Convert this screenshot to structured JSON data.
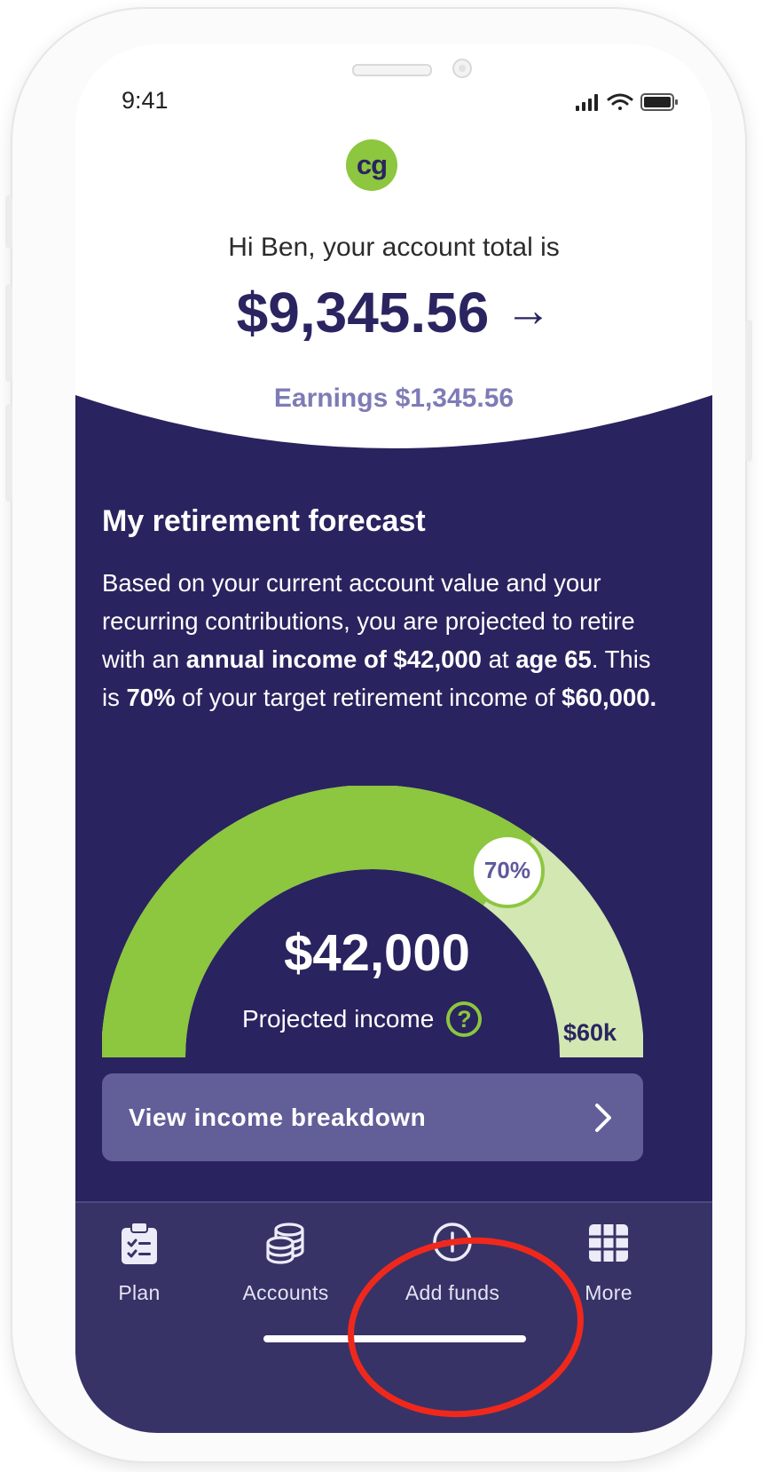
{
  "status_bar": {
    "time": "9:41"
  },
  "brand": {
    "logo_text": "cg",
    "color_green": "#8dc63f",
    "color_navy": "#2a2560"
  },
  "account": {
    "greeting": "Hi Ben, your account total is",
    "total": "$9,345.56",
    "arrow": "→",
    "earnings": "Earnings $1,345.56"
  },
  "forecast": {
    "title": "My retirement forecast",
    "text_1": "Based on your current account value and your recurring contributions, you are projected to retire with an ",
    "bold_1": "annual income of $42,000",
    "text_2": " at ",
    "bold_2": "age 65",
    "text_3": ". This is ",
    "bold_3": "70%",
    "text_4": " of your target retirement income of ",
    "bold_4": "$60,000."
  },
  "gauge": {
    "progress_fraction": 0.7,
    "percent_label": "70%",
    "amount": "$42,000",
    "label": "Projected income",
    "help_symbol": "?",
    "target_label": "$60k",
    "color_filled": "#8dc63f",
    "color_remaining": "#d2e7b1"
  },
  "breakdown_button": {
    "label": "View income breakdown",
    "icon": "chevron-right-icon"
  },
  "tabbar": {
    "items": [
      {
        "label": "Plan",
        "icon": "clipboard-checklist-icon"
      },
      {
        "label": "Accounts",
        "icon": "coin-stack-icon"
      },
      {
        "label": "Add funds",
        "icon": "plus-circle-icon"
      },
      {
        "label": "More",
        "icon": "grid-icon"
      }
    ]
  },
  "annotation": {
    "shape": "ellipse",
    "target": "Add funds",
    "color": "#f0281c"
  }
}
